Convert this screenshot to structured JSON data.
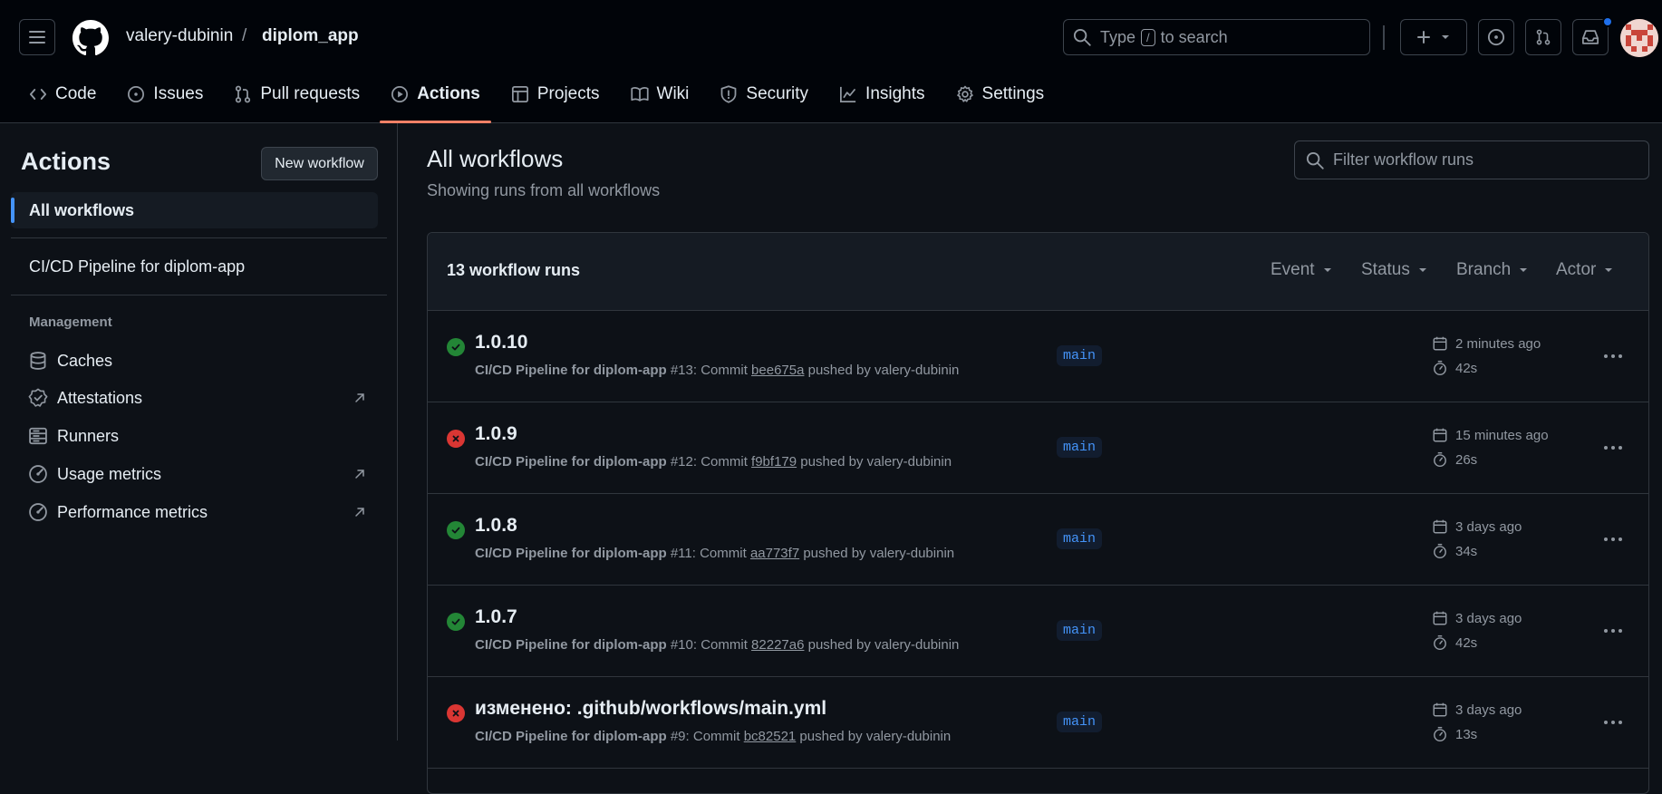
{
  "header": {
    "owner": "valery-dubinin",
    "separator": "/",
    "repo": "diplom_app",
    "search_prefix": "Type",
    "search_key": "/",
    "search_suffix": "to search"
  },
  "tabs": [
    {
      "label": "Code",
      "icon": "code-icon"
    },
    {
      "label": "Issues",
      "icon": "issue-icon"
    },
    {
      "label": "Pull requests",
      "icon": "pull-request-icon"
    },
    {
      "label": "Actions",
      "icon": "play-icon",
      "active": true
    },
    {
      "label": "Projects",
      "icon": "table-icon"
    },
    {
      "label": "Wiki",
      "icon": "book-icon"
    },
    {
      "label": "Security",
      "icon": "shield-icon"
    },
    {
      "label": "Insights",
      "icon": "graph-icon"
    },
    {
      "label": "Settings",
      "icon": "gear-icon"
    }
  ],
  "sidebar": {
    "title": "Actions",
    "new_workflow": "New workflow",
    "all_workflows": "All workflows",
    "workflow": "CI/CD Pipeline for diplom-app",
    "management_heading": "Management",
    "management": [
      {
        "label": "Caches",
        "icon": "database-icon"
      },
      {
        "label": "Attestations",
        "icon": "verified-icon",
        "external": true
      },
      {
        "label": "Runners",
        "icon": "server-icon"
      },
      {
        "label": "Usage metrics",
        "icon": "meter-icon",
        "external": true
      },
      {
        "label": "Performance metrics",
        "icon": "meter-icon",
        "external": true
      }
    ]
  },
  "main": {
    "title": "All workflows",
    "subtitle": "Showing runs from all workflows",
    "filter_placeholder": "Filter workflow runs",
    "runs_count": "13 workflow runs",
    "filters": [
      "Event",
      "Status",
      "Branch",
      "Actor"
    ]
  },
  "runs": [
    {
      "title": "1.0.10",
      "status": "success",
      "workflow": "CI/CD Pipeline for diplom-app",
      "number": "#13",
      "sha": "bee675a",
      "actor": "valery-dubinin",
      "branch": "main",
      "when": "2 minutes ago",
      "duration": "42s"
    },
    {
      "title": "1.0.9",
      "status": "failure",
      "workflow": "CI/CD Pipeline for diplom-app",
      "number": "#12",
      "sha": "f9bf179",
      "actor": "valery-dubinin",
      "branch": "main",
      "when": "15 minutes ago",
      "duration": "26s"
    },
    {
      "title": "1.0.8",
      "status": "success",
      "workflow": "CI/CD Pipeline for diplom-app",
      "number": "#11",
      "sha": "aa773f7",
      "actor": "valery-dubinin",
      "branch": "main",
      "when": "3 days ago",
      "duration": "34s"
    },
    {
      "title": "1.0.7",
      "status": "success",
      "workflow": "CI/CD Pipeline for diplom-app",
      "number": "#10",
      "sha": "82227a6",
      "actor": "valery-dubinin",
      "branch": "main",
      "when": "3 days ago",
      "duration": "42s"
    },
    {
      "title": "изменено: .github/workflows/main.yml",
      "status": "failure",
      "workflow": "CI/CD Pipeline for diplom-app",
      "number": "#9",
      "sha": "bc82521",
      "actor": "valery-dubinin",
      "branch": "main",
      "when": "3 days ago",
      "duration": "13s"
    }
  ],
  "colors": {
    "success": "#238636",
    "failure": "#da3633",
    "accent": "#f78166",
    "link": "#4493f8"
  }
}
